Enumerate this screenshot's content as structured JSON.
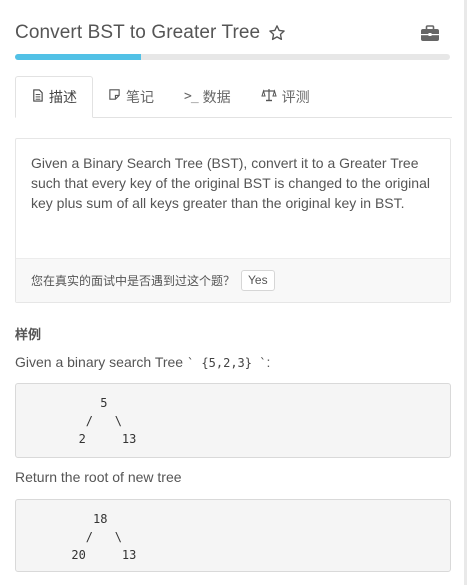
{
  "header": {
    "title": "Convert BST to Greater Tree",
    "favorite_icon": "star-outline-icon",
    "right_icon": "briefcase-icon"
  },
  "progress": {
    "fraction": 0.29,
    "color": "#52c1e6"
  },
  "tabs": [
    {
      "label": "描述",
      "icon": "document-icon"
    },
    {
      "label": "笔记",
      "icon": "note-icon"
    },
    {
      "label": "数据",
      "icon": "terminal-icon",
      "icon_text": ">_"
    },
    {
      "label": "评测",
      "icon": "scale-icon"
    }
  ],
  "description": {
    "text": "Given a Binary Search Tree (BST), convert it to a Greater Tree such that every key of the original BST is changed to the original key plus sum of all keys greater than the original key in BST.",
    "question": "您在真实的面试中是否遇到过这个题？",
    "yes_label": "Yes"
  },
  "example": {
    "heading": "样例",
    "intro_prefix": "Given a binary search Tree ",
    "intro_code": "` {5,2,3} `",
    "intro_suffix": ":",
    "input_tree": "          5\n        /   \\\n       2     13",
    "output_label": "Return the root of new tree",
    "output_tree": "         18\n        /   \\\n      20     13"
  }
}
